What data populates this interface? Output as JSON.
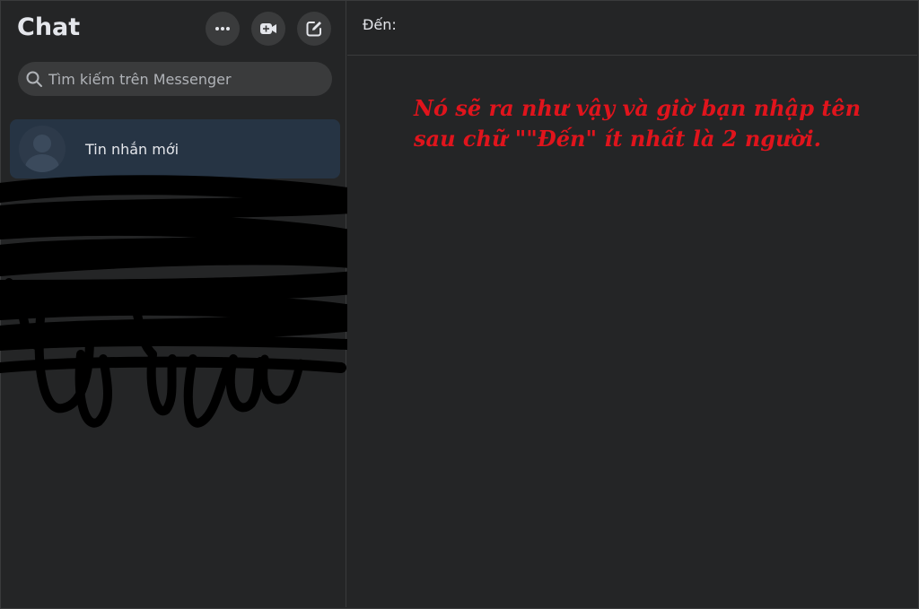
{
  "sidebar": {
    "title": "Chat",
    "search": {
      "placeholder": "Tìm kiếm trên Messenger",
      "value": ""
    },
    "conversations": [
      {
        "label": "Tin nhắn mới"
      }
    ]
  },
  "main": {
    "to_label": "Đến:",
    "to_value": ""
  },
  "annotation": {
    "line1": "Nó sẽ ra như vậy và giờ bạn nhập tên",
    "line2": "sau chữ \"\"Đến\" ít nhất là 2 người."
  },
  "colors": {
    "background": "#242526",
    "button": "#3a3b3c",
    "selected_item": "#263444",
    "annotation_text": "#e0141c"
  },
  "icons": [
    "more-options-icon",
    "video-call-icon",
    "compose-icon",
    "search-icon",
    "default-avatar-icon"
  ]
}
